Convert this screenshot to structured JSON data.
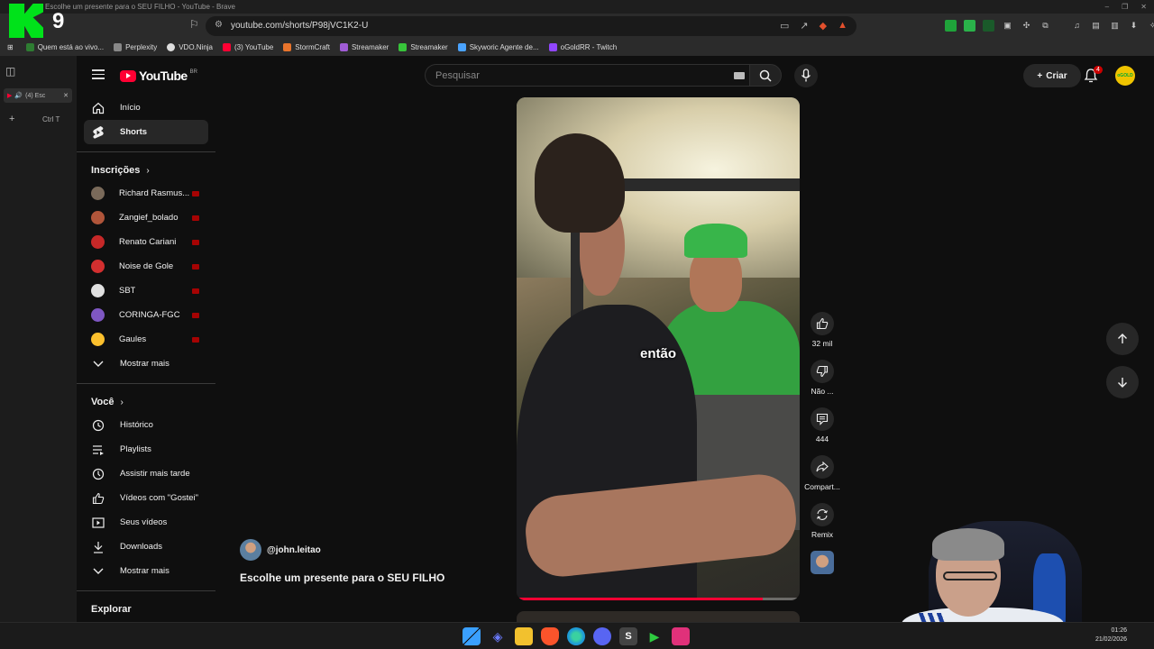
{
  "browser": {
    "window_title": "(4) Escolhe um presente para o SEU FILHO - YouTube - Brave",
    "url": "youtube.com/shorts/P98jVC1K2-U",
    "bookmarks": [
      {
        "label": "Quem está ao vivo...",
        "color": "#2e7d32"
      },
      {
        "label": "Perplexity",
        "color": "#888888"
      },
      {
        "label": "VDO.Ninja",
        "color": "#dddddd"
      },
      {
        "label": "(3) YouTube",
        "color": "#ff0033"
      },
      {
        "label": "StormCraft",
        "color": "#e8742c"
      },
      {
        "label": "Streamaker",
        "color": "#a05cd6"
      },
      {
        "label": "Streamaker",
        "color": "#37c43a"
      },
      {
        "label": "Skyworic Agente de...",
        "color": "#4aa3ff"
      },
      {
        "label": "oGoldRR - Twitch",
        "color": "#9146ff"
      }
    ],
    "open_tab_label": "(4) Esc",
    "new_tab_hint": "Ctrl T"
  },
  "overlay_logo": {
    "text": "9",
    "color": "#00e21a"
  },
  "youtube": {
    "logo_text": "YouTube",
    "country": "BR",
    "search_placeholder": "Pesquisar",
    "create_label": "Criar",
    "notification_count": "4",
    "avatar_text": "oGOLD"
  },
  "sidebar": {
    "main": [
      {
        "label": "Início",
        "icon": "home-icon"
      },
      {
        "label": "Shorts",
        "icon": "shorts-icon"
      }
    ],
    "subscriptions_title": "Inscrições",
    "subscriptions": [
      {
        "label": "Richard Rasmus...",
        "color": "#7a6a5a"
      },
      {
        "label": "Zangief_bolado",
        "color": "#b0553a"
      },
      {
        "label": "Renato Cariani",
        "color": "#c62828"
      },
      {
        "label": "Noise de Gole",
        "color": "#d32f2f"
      },
      {
        "label": "SBT",
        "color": "#e0e0e0"
      },
      {
        "label": "CORINGA-FGC",
        "color": "#7e57c2"
      },
      {
        "label": "Gaules",
        "color": "#fbc02d"
      }
    ],
    "show_more": "Mostrar mais",
    "you_title": "Você",
    "you_items": [
      {
        "label": "Histórico",
        "icon": "history-icon"
      },
      {
        "label": "Playlists",
        "icon": "playlists-icon"
      },
      {
        "label": "Assistir mais tarde",
        "icon": "watch-later-icon"
      },
      {
        "label": "Vídeos com \"Gostei\"",
        "icon": "liked-icon"
      },
      {
        "label": "Seus vídeos",
        "icon": "your-videos-icon"
      },
      {
        "label": "Downloads",
        "icon": "download-icon"
      },
      {
        "label": "Mostrar mais",
        "icon": "chevron-down-icon"
      }
    ],
    "explore_title": "Explorar"
  },
  "short": {
    "caption": "então",
    "channel": "@john.leitao",
    "title": "Escolhe um presente para o SEU FILHO",
    "progress": 0.87,
    "likes": "32 mil",
    "dislike_label": "Não ...",
    "comments": "444",
    "share_label": "Compart...",
    "remix_label": "Remix"
  },
  "taskbar": {
    "time": "01:26",
    "date": "21/02/2026",
    "apps": [
      {
        "name": "windows-start",
        "color": "#3aa0ff"
      },
      {
        "name": "app-diamond",
        "color": "#6b7bff"
      },
      {
        "name": "file-explorer",
        "color": "#f2c12e"
      },
      {
        "name": "brave",
        "color": "#fb542b"
      },
      {
        "name": "edge",
        "color": "#1e9bd7"
      },
      {
        "name": "discord",
        "color": "#5865f2"
      },
      {
        "name": "app-s",
        "color": "#444444"
      },
      {
        "name": "app-green-play",
        "color": "#2ecc40"
      },
      {
        "name": "app-pink",
        "color": "#e0317a"
      }
    ]
  }
}
